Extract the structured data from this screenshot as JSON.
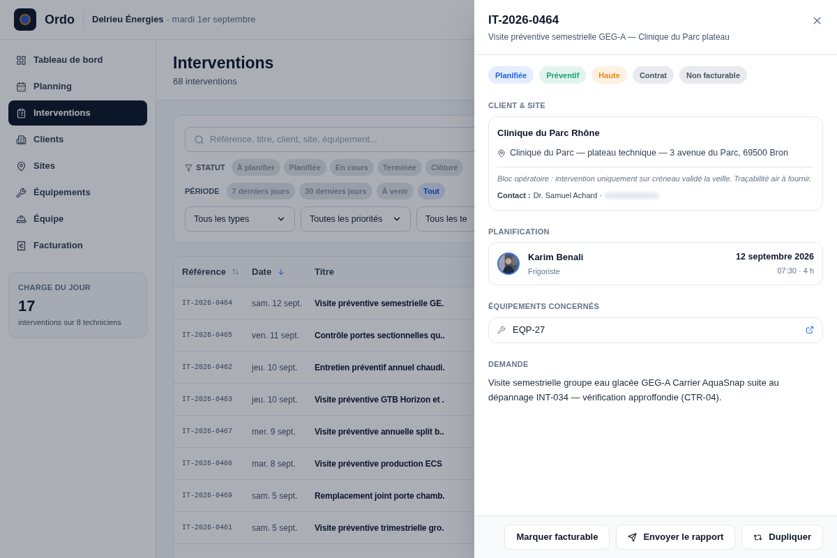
{
  "header": {
    "app_name": "Ordo",
    "company": "Delrieu Énergies",
    "date": "· mardi 1er septembre"
  },
  "sidebar": {
    "items": [
      {
        "label": "Tableau de bord",
        "selected": false
      },
      {
        "label": "Planning",
        "selected": false
      },
      {
        "label": "Interventions",
        "selected": true
      },
      {
        "label": "Clients",
        "selected": false
      },
      {
        "label": "Sites",
        "selected": false
      },
      {
        "label": "Équipements",
        "selected": false
      },
      {
        "label": "Équipe",
        "selected": false
      },
      {
        "label": "Facturation",
        "selected": false
      }
    ],
    "load_card": {
      "title": "CHARGE DU JOUR",
      "value": "17",
      "caption": "interventions sur 8 techniciens"
    }
  },
  "page": {
    "title": "Interventions",
    "subtitle": "68 interventions"
  },
  "filters": {
    "search_placeholder": "Référence, titre, client, site, équipement...",
    "status_label": "STATUT",
    "status_chips": [
      {
        "label": "À planifier",
        "selected": false
      },
      {
        "label": "Planifiée",
        "selected": false
      },
      {
        "label": "En cours",
        "selected": false
      },
      {
        "label": "Terminée",
        "selected": false
      },
      {
        "label": "Clôturé",
        "selected": false
      }
    ],
    "period_label": "PÉRIODE",
    "period_chips": [
      {
        "label": "7 derniers jours",
        "selected": false
      },
      {
        "label": "30 derniers jours",
        "selected": false
      },
      {
        "label": "À venir",
        "selected": false
      },
      {
        "label": "Tout",
        "selected": true
      }
    ],
    "selects": [
      "Tous les types",
      "Toutes les priorités",
      "Tous les te"
    ]
  },
  "table": {
    "columns": [
      {
        "label": "Référence",
        "sorted": false
      },
      {
        "label": "Date",
        "sorted": true
      },
      {
        "label": "Titre"
      }
    ],
    "rows": [
      [
        "IT-2026-0464",
        "sam. 12 sept.",
        "Visite préventive semestrielle GE."
      ],
      [
        "IT-2026-0465",
        "ven. 11 sept.",
        "Contrôle portes sectionnelles qu.."
      ],
      [
        "IT-2026-0462",
        "jeu. 10 sept.",
        "Entretien préventif annuel chaudi."
      ],
      [
        "IT-2026-0463",
        "jeu. 10 sept.",
        "Visite préventive GTB Horizon et ."
      ],
      [
        "IT-2026-0467",
        "mer. 9 sept.",
        "Visite préventive annuelle split b.."
      ],
      [
        "IT-2026-0466",
        "mar. 8 sept.",
        "Visite préventive production ECS"
      ],
      [
        "IT-2026-0469",
        "sam. 5 sept.",
        "Remplacement joint porte chamb."
      ],
      [
        "IT-2026-0461",
        "sam. 5 sept.",
        "Visite préventive trimestrielle gro."
      ]
    ]
  },
  "drawer": {
    "title": "IT-2026-0464",
    "subtitle": "Visite préventive semestrielle GEG-A — Clinique du Parc plateau",
    "tags": [
      {
        "label": "Planifiée",
        "color": "#2563eb"
      },
      {
        "label": "Préventif",
        "color": "#16a070"
      },
      {
        "label": "Haute",
        "color": "#ea8a1a"
      },
      {
        "label": "Contrat",
        "color": "#475569"
      },
      {
        "label": "Non facturable",
        "color": "#475569"
      }
    ],
    "client_section": {
      "heading": "CLIENT & SITE",
      "client": "Clinique du Parc Rhône",
      "address": "Clinique du Parc — plateau technique — 3 avenue du Parc, 69500 Bron",
      "note": "Bloc opératoire : intervention uniquement sur créneau validé la veille. Traçabilité air à fournir.",
      "contact_label": "Contact :",
      "contact_name": "Dr. Samuel Achard ·"
    },
    "planning_section": {
      "heading": "PLANIFICATION",
      "technician": "Karim Benali",
      "role": "Frigoriste",
      "date": "12 septembre 2026",
      "time": "07:30 · 4 h"
    },
    "equipment_section": {
      "heading": "ÉQUIPEMENTS CONCERNÉS",
      "items": [
        "EQP-27"
      ]
    },
    "request_section": {
      "heading": "DEMANDE",
      "text": "Visite semestrielle groupe eau glacée GEG-A Carrier AquaSnap suite au dépannage INT-034 — vérification approffondie (CTR-04)."
    },
    "actions": [
      {
        "label": "Marquer facturable",
        "kind": "plain"
      },
      {
        "label": "Envoyer le rapport",
        "kind": "send"
      },
      {
        "label": "Dupliquer",
        "kind": "duplicate"
      }
    ]
  }
}
